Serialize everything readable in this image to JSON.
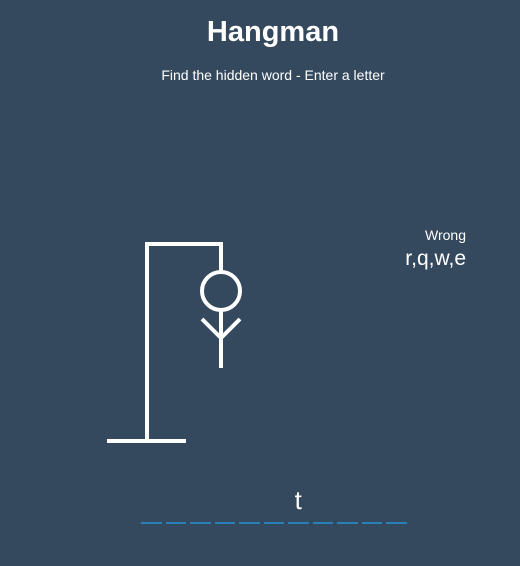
{
  "title": "Hangman",
  "subtitle": "Find the hidden word - Enter a letter",
  "wrong": {
    "label": "Wrong",
    "letters": "r,q,w,e"
  },
  "word": {
    "slots": [
      "",
      "",
      "",
      "",
      "",
      "",
      "t",
      "",
      "",
      "",
      ""
    ]
  },
  "colors": {
    "background": "#34495e",
    "figure": "#ffffff",
    "underline": "#2980b9"
  }
}
